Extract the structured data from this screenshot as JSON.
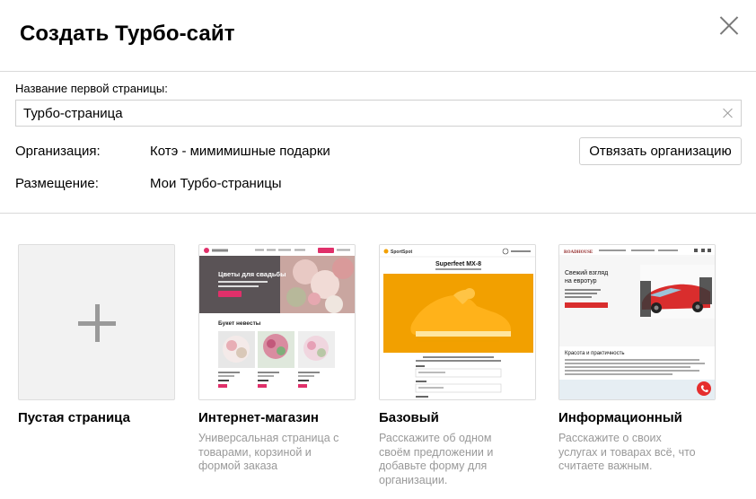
{
  "header": {
    "title": "Создать Турбо-сайт"
  },
  "form": {
    "name_label": "Название первой страницы:",
    "name_value": "Турбо-страница",
    "org_label": "Организация:",
    "org_value": "Котэ - мимимишные подарки",
    "unlink_button": "Отвязать организацию",
    "placement_label": "Размещение:",
    "placement_value": "Мои Турбо-страницы"
  },
  "templates": [
    {
      "title": "Пустая страница",
      "description": ""
    },
    {
      "title": "Интернет-магазин",
      "description": "Универсальная страница с товарами, корзиной и формой заказа"
    },
    {
      "title": "Базовый",
      "description": "Расскажите об одном своём предложении и добавьте форму для организации."
    },
    {
      "title": "Информационный",
      "description": "Расскажите о своих услугах и товарах всё, что считаете важным."
    }
  ],
  "previews": {
    "shop": {
      "hero": "Цветы для свадьбы",
      "section": "Букет невесты"
    },
    "basic": {
      "brand": "SportSpot",
      "product": "Superfeet MX-8"
    },
    "info": {
      "brand": "ROADHOUSE",
      "hero": "Свежий взгляд на евротур",
      "section": "Красота и практичность"
    }
  },
  "colors": {
    "accent_pink": "#e0306a",
    "shoe_orange": "#f2a000",
    "call_red": "#e52e2e"
  }
}
